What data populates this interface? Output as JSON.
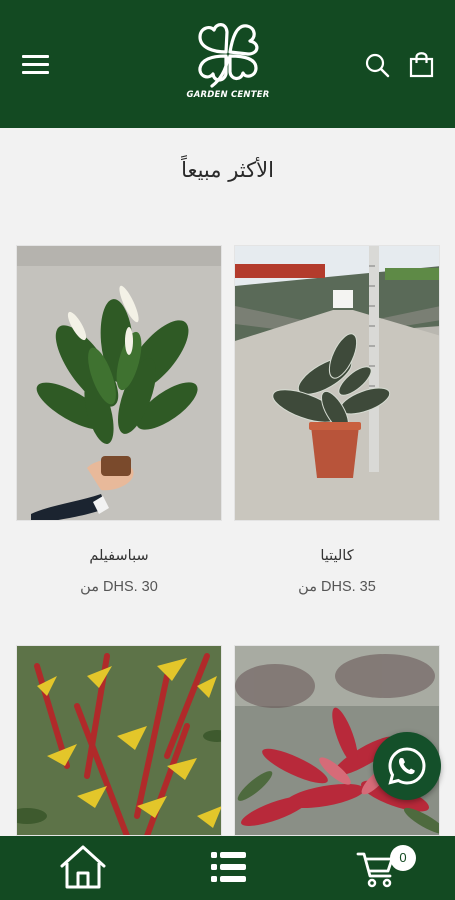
{
  "header": {
    "logo_text": "GARDEN CENTER",
    "menu_icon": "hamburger-icon",
    "search_icon": "search-icon",
    "bag_icon": "shopping-bag-icon",
    "background_color": "#134a22"
  },
  "section": {
    "title": "الأكثر مبيعاً"
  },
  "products": [
    {
      "name": "كاليتيا",
      "price": "DHS. 35 من"
    },
    {
      "name": "سباسفيلم",
      "price": "DHS. 30 من"
    },
    {
      "name": "",
      "price": ""
    },
    {
      "name": "",
      "price": ""
    }
  ],
  "whatsapp": {
    "icon": "whatsapp-icon",
    "color": "#14502a"
  },
  "bottom_nav": {
    "items": [
      {
        "icon": "home-icon"
      },
      {
        "icon": "list-icon"
      },
      {
        "icon": "cart-icon"
      }
    ],
    "cart_count": "0"
  }
}
